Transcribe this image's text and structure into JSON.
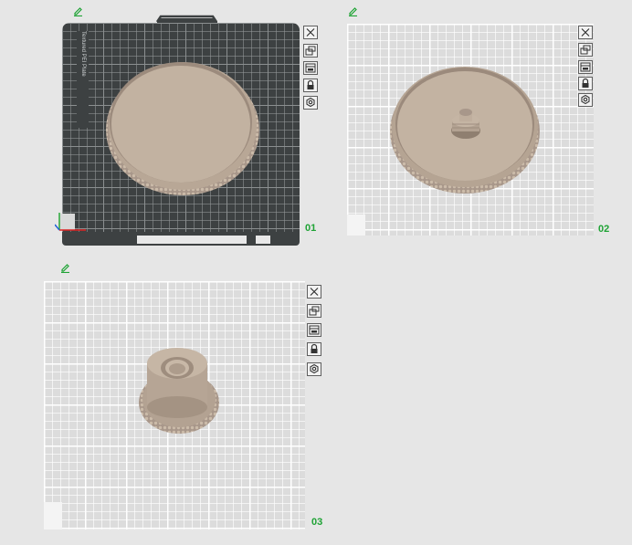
{
  "colors": {
    "plate_label": "#1fa335",
    "edit_icon": "#1fa335",
    "model": "#bfae9d",
    "model_dark": "#8f7f70",
    "plate_selected": "#3d4142",
    "plate_normal": "#dcdcdc"
  },
  "plates": [
    {
      "label": "01",
      "selected": true,
      "plate_name_vertical": "Textured PEI Plate",
      "model": "bowl-rim",
      "toolbar": [
        {
          "name": "close-icon"
        },
        {
          "name": "arrange-icon"
        },
        {
          "name": "orient-icon"
        },
        {
          "name": "lock-icon"
        },
        {
          "name": "settings-icon"
        }
      ]
    },
    {
      "label": "02",
      "selected": false,
      "model": "bowl-with-knob",
      "toolbar": [
        {
          "name": "close-icon"
        },
        {
          "name": "arrange-icon"
        },
        {
          "name": "orient-icon"
        },
        {
          "name": "lock-icon"
        },
        {
          "name": "settings-icon"
        }
      ]
    },
    {
      "label": "03",
      "selected": false,
      "model": "cap",
      "toolbar": [
        {
          "name": "close-icon"
        },
        {
          "name": "arrange-icon"
        },
        {
          "name": "orient-icon"
        },
        {
          "name": "lock-icon"
        },
        {
          "name": "settings-icon"
        }
      ]
    }
  ]
}
